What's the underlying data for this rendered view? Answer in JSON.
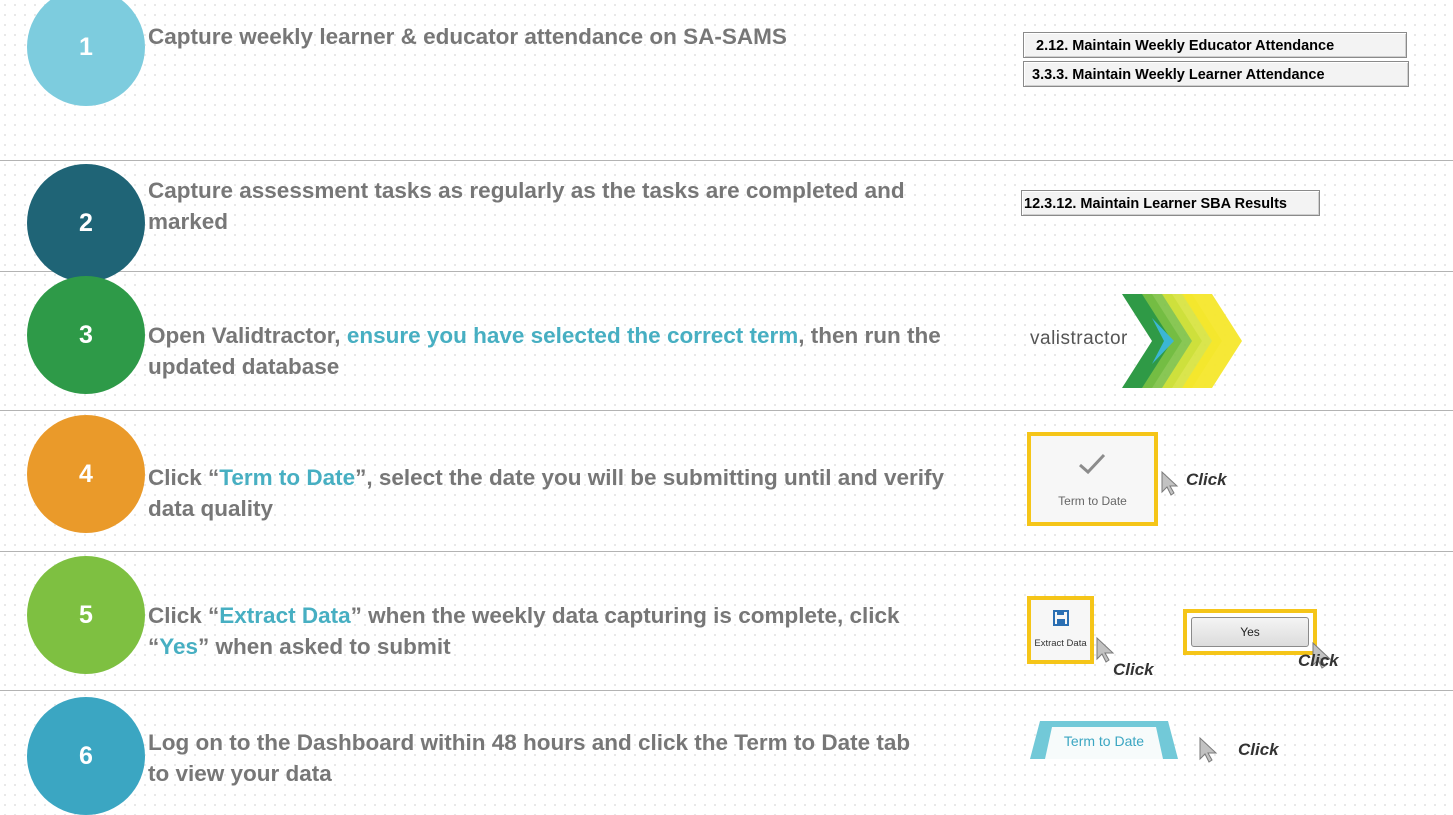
{
  "colors": {
    "step1": "#7dccde",
    "step2": "#1f6476",
    "step3": "#2e9a48",
    "step4": "#ea9a2a",
    "step5": "#7ec041",
    "step6": "#3ba6c2",
    "highlight": "#47afc2",
    "text": "#777777",
    "frame": "#f5c518"
  },
  "steps": [
    {
      "number": "1",
      "text": "Capture weekly learner & educator attendance on SA-SAMS",
      "menu_items": [
        "2.12.  Maintain Weekly Educator Attendance",
        "3.3.3.  Maintain Weekly Learner Attendance"
      ]
    },
    {
      "number": "2",
      "text": "Capture assessment tasks as regularly as the tasks are completed and marked",
      "menu_items": [
        "12.3.12.  Maintain Learner SBA Results"
      ]
    },
    {
      "number": "3",
      "text_a": "Open Validtractor, ",
      "text_b": "ensure you have selected the correct term",
      "text_c": ", then run the updated database",
      "logo_text": "valistractor"
    },
    {
      "number": "4",
      "text_a": "Click “",
      "text_b": "Term to Date",
      "text_c": "”, select the date you will be submitting until and verify data quality",
      "button_label": "Term to Date",
      "click_label": "Click"
    },
    {
      "number": "5",
      "text_a": "Click “",
      "text_b": "Extract Data",
      "text_c": "” when the weekly data capturing is complete, click “",
      "text_d": "Yes",
      "text_e": "” when asked to submit",
      "extract_label": "Extract Data",
      "yes_label": "Yes",
      "click_label_1": "Click",
      "click_label_2": "Click"
    },
    {
      "number": "6",
      "text": "Log on to the Dashboard within 48 hours and click the Term to Date tab to view your data",
      "tab_label": "Term to Date",
      "click_label": "Click"
    }
  ]
}
